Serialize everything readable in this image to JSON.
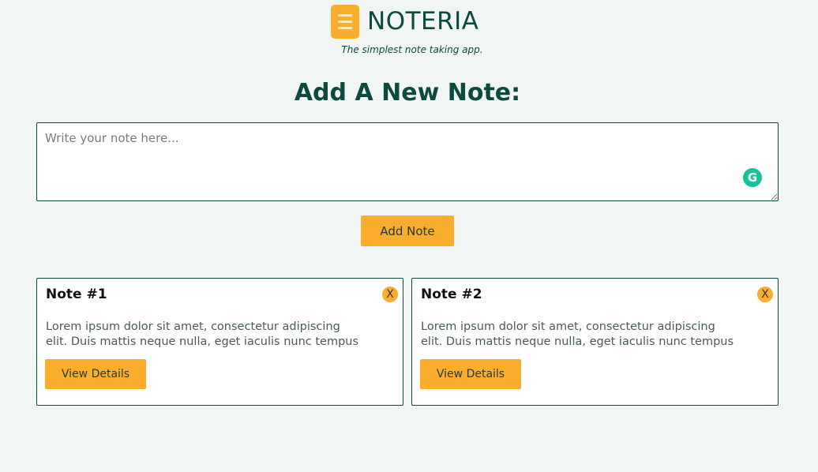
{
  "header": {
    "brand_name": "NOTERIA",
    "tagline": "The simplest note taking app."
  },
  "add_section": {
    "title": "Add A New Note:",
    "input_placeholder": "Write your note here...",
    "input_value": "",
    "add_button_label": "Add Note"
  },
  "notes": [
    {
      "title": "Note #1",
      "close_label": "X",
      "body_line_1": "Lorem ipsum dolor sit amet, consectetur adipiscing",
      "body_line_2": "elit. Duis mattis neque nulla, eget iaculis nunc tempus",
      "details_label": "View Details"
    },
    {
      "title": "Note #2",
      "close_label": "X",
      "body_line_1": "Lorem ipsum dolor sit amet, consectetur adipiscing",
      "body_line_2": "elit. Duis mattis neque nulla, eget iaculis nunc tempus",
      "details_label": "View Details"
    }
  ],
  "icons": {
    "logo": "note-stack-icon",
    "grammarly": "grammarly-icon"
  },
  "colors": {
    "background": "#f1f5f3",
    "primary_text": "#0c4a3e",
    "accent": "#fbad2e",
    "grammarly": "#15c39a"
  }
}
